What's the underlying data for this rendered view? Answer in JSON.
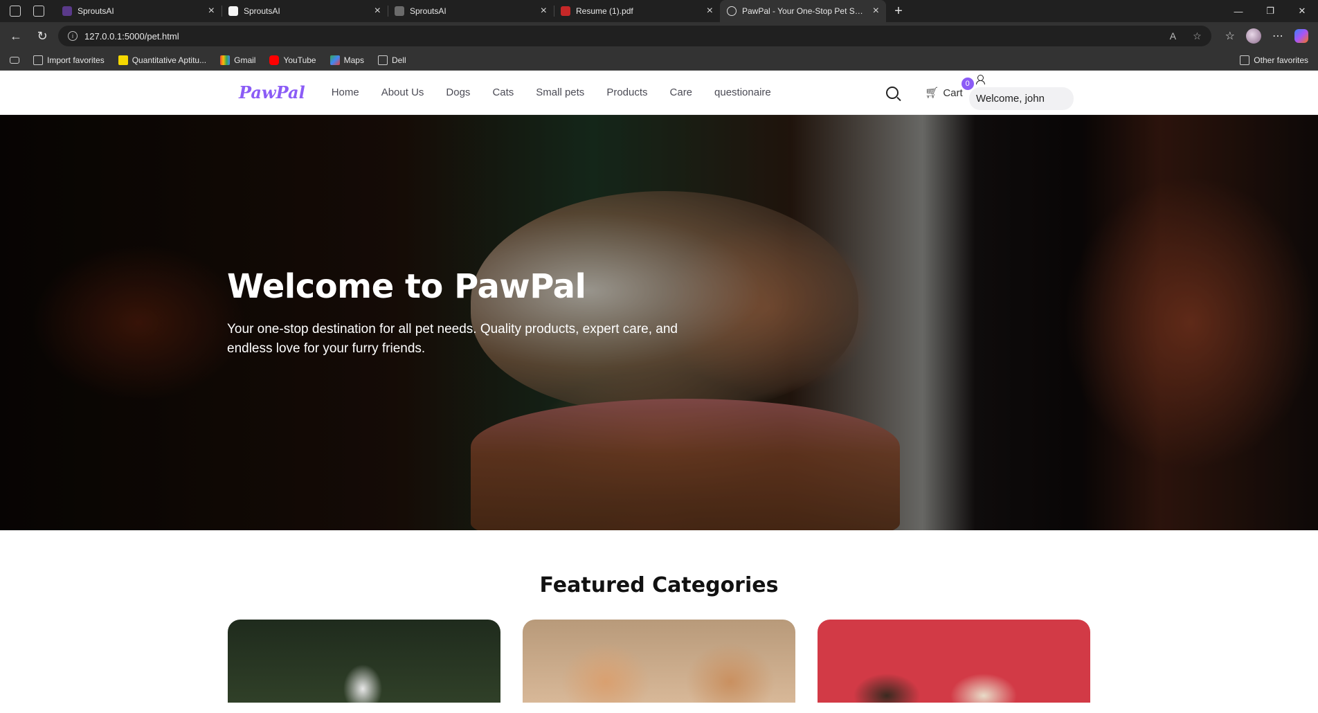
{
  "browser": {
    "tabs": [
      {
        "title": "SproutsAI",
        "favicon_color": "#5a3a8a",
        "active": false
      },
      {
        "title": "SproutsAI",
        "favicon_color": "#f5f5f5",
        "active": false
      },
      {
        "title": "SproutsAI",
        "favicon_color": "#6b6b6b",
        "active": false
      },
      {
        "title": "Resume (1).pdf",
        "favicon_color": "#c62828",
        "active": false
      },
      {
        "title": "PawPal - Your One-Stop Pet Shop",
        "favicon_color": "#333333",
        "active": true
      }
    ],
    "url": "127.0.0.1:5000/pet.html",
    "bookmarks": [
      {
        "label": "Import favorites",
        "icon": "import-icon"
      },
      {
        "label": "Quantitative Aptitu...",
        "icon": "b-icon",
        "color": "#f5d800"
      },
      {
        "label": "Gmail",
        "icon": "gmail-icon"
      },
      {
        "label": "YouTube",
        "icon": "youtube-icon",
        "color": "#ff0000"
      },
      {
        "label": "Maps",
        "icon": "maps-icon"
      },
      {
        "label": "Dell",
        "icon": "folder-icon"
      }
    ],
    "other_favorites": "Other favorites"
  },
  "site": {
    "logo": "PawPal",
    "nav": [
      "Home",
      "About Us",
      "Dogs",
      "Cats",
      "Small pets",
      "Products",
      "Care",
      "questionaire"
    ],
    "cart_label": "Cart",
    "cart_count": "0",
    "welcome": "Welcome, john",
    "accent_color": "#8b5cf6"
  },
  "hero": {
    "title": "Welcome to PawPal",
    "subtitle": "Your one-stop destination for all pet needs. Quality products, expert care, and endless love for your furry friends."
  },
  "featured": {
    "heading": "Featured Categories"
  }
}
